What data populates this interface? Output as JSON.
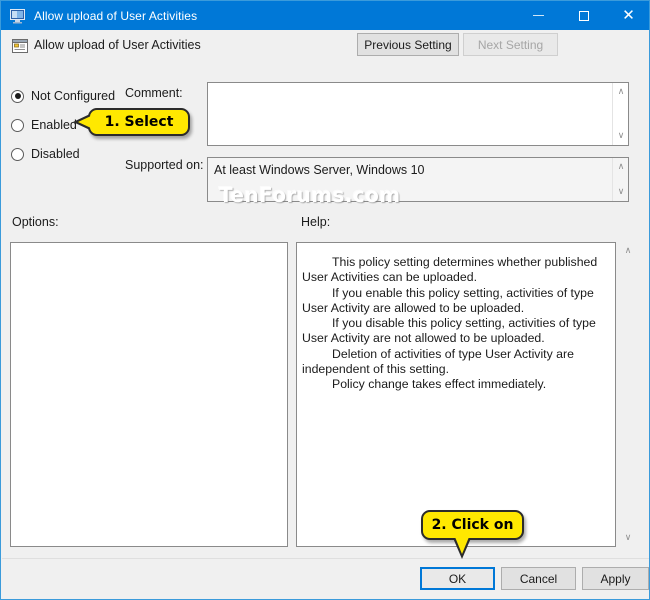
{
  "window": {
    "title": "Allow upload of User Activities",
    "icon": "policy-monitor-icon",
    "minimize_label": "Minimize",
    "maximize_label": "Maximize",
    "close_label": "Close",
    "close_glyph": "✕"
  },
  "header": {
    "icon": "policy-setting-icon",
    "title": "Allow upload of User Activities",
    "previous_setting_label": "Previous Setting",
    "next_setting_label": "Next Setting"
  },
  "state_options": [
    {
      "label": "Not Configured",
      "selected": true
    },
    {
      "label": "Enabled",
      "selected": false
    },
    {
      "label": "Disabled",
      "selected": false
    }
  ],
  "comment": {
    "label": "Comment:",
    "value": "",
    "placeholder": ""
  },
  "supported_on": {
    "label": "Supported on:",
    "value": "At least Windows Server, Windows 10"
  },
  "panels": {
    "options_label": "Options:",
    "help_label": "Help:",
    "options_content": ""
  },
  "help": {
    "paragraphs": [
      "This policy setting determines whether published User Activities can be uploaded.",
      "If you enable this policy setting, activities of type User Activity are allowed to be uploaded.",
      "If you disable this policy setting, activities of type User Activity are not allowed to be uploaded.",
      "Deletion of activities of type User Activity are independent of this setting.",
      "Policy change takes effect immediately."
    ]
  },
  "buttons": {
    "ok": "OK",
    "cancel": "Cancel",
    "apply": "Apply"
  },
  "callouts": [
    {
      "text": "1. Select",
      "points_to": "enabled-radio"
    },
    {
      "text": "2. Click on",
      "points_to": "ok-button"
    }
  ],
  "watermark": "TenForums.com",
  "colors": {
    "titlebar": "#0078d7",
    "window_border": "#3b9bdb",
    "dialog_bg": "#f0f0f0",
    "callout_fill": "#ffe800",
    "focus_border": "#0078d7",
    "text": "#1b1b1b",
    "disabled_text": "#a6a6a6"
  },
  "scrollbars": {
    "up_glyph": "∧",
    "down_glyph": "∨"
  }
}
